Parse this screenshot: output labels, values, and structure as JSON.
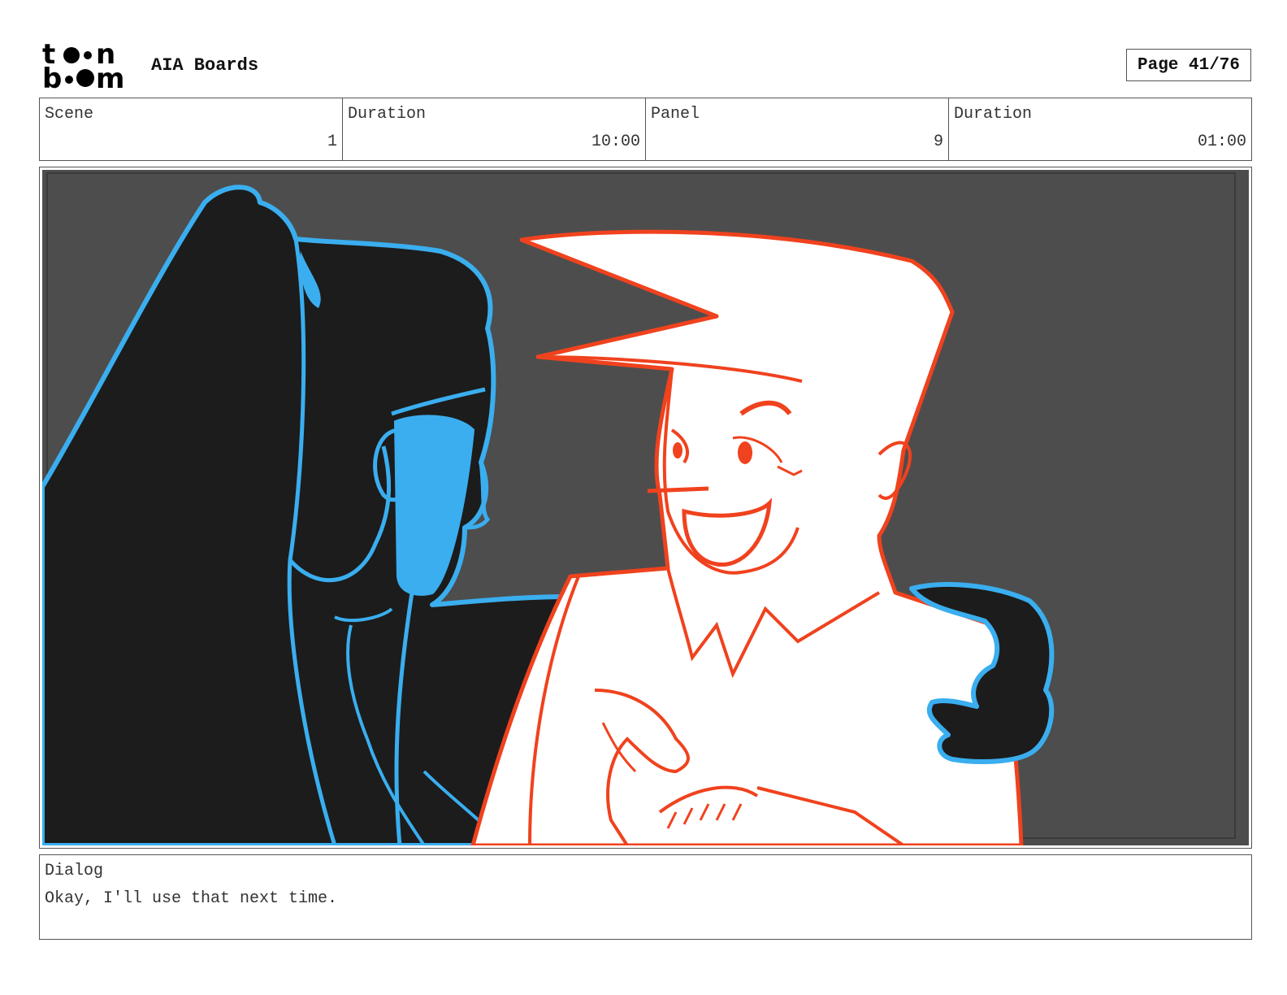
{
  "header": {
    "logo_text": "toon boom",
    "project_title": "AIA Boards",
    "page_label": "Page 41/76"
  },
  "info": {
    "scene_label": "Scene",
    "scene_value": "1",
    "scene_duration_label": "Duration",
    "scene_duration_value": "10:00",
    "panel_label": "Panel",
    "panel_value": "9",
    "panel_duration_label": "Duration",
    "panel_duration_value": "01:00"
  },
  "dialog": {
    "label": "Dialog",
    "text": "Okay, I'll use that next time."
  },
  "colors": {
    "background": "#4d4d4d",
    "character_left_outline": "#3aaeef",
    "character_left_fill": "#1c1c1c",
    "character_right_outline": "#f0421e",
    "character_right_fill": "#ffffff"
  }
}
